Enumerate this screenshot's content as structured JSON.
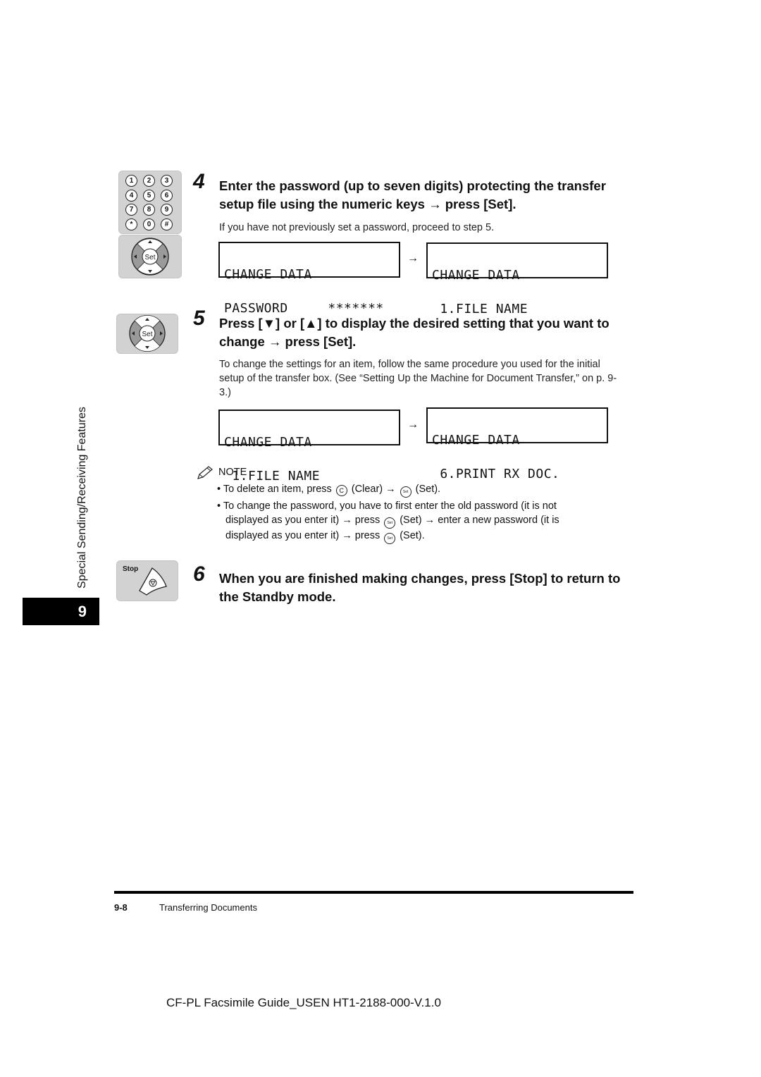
{
  "side_tab": {
    "label": "Special Sending/Receiving Features",
    "chapter": "9"
  },
  "keys": {
    "numeric": [
      "1",
      "2",
      "3",
      "4",
      "5",
      "6",
      "7",
      "8",
      "9",
      "*",
      "0",
      "#"
    ],
    "set_label": "Set",
    "stop_label": "Stop",
    "clear_label": "C"
  },
  "steps": [
    {
      "number": "4",
      "heading": "Enter the password (up to seven digits) protecting the transfer setup file using the numeric keys → press [Set].",
      "body": "If you have not previously set a password, proceed to step 5.",
      "lcd_from": [
        "CHANGE DATA",
        "PASSWORD     *******"
      ],
      "lcd_to": [
        "CHANGE DATA",
        " 1.FILE NAME"
      ]
    },
    {
      "number": "5",
      "heading": "Press [▼] or [▲] to display the desired setting that you want to change → press [Set].",
      "body": "To change the settings for an item, follow the same procedure you used for the initial setup of the transfer box. (See “Setting Up the Machine for Document Transfer,” on p. 9-3.)",
      "lcd_from": [
        "CHANGE DATA",
        " 1.FILE NAME"
      ],
      "lcd_to": [
        "CHANGE DATA",
        " 6.PRINT RX DOC."
      ]
    },
    {
      "number": "6",
      "heading": "When you are finished making changes, press [Stop] to return to the Standby mode."
    }
  ],
  "arrow": "→",
  "note": {
    "title": "NOTE",
    "item1": {
      "a": "• To delete an item, press",
      "b": "(Clear) →",
      "c": "(Set)."
    },
    "item2": {
      "line1": "• To change the password, you have to first enter the old password (it is not",
      "line2a": "displayed as you enter it) → press",
      "line2b": "(Set) → enter a new password (it is",
      "line3a": "displayed as you enter it) → press",
      "line3b": "(Set)."
    }
  },
  "footer": {
    "page": "9-8",
    "section": "Transferring Documents",
    "doc_id": "CF-PL Facsimile Guide_USEN HT1-2188-000-V.1.0"
  }
}
